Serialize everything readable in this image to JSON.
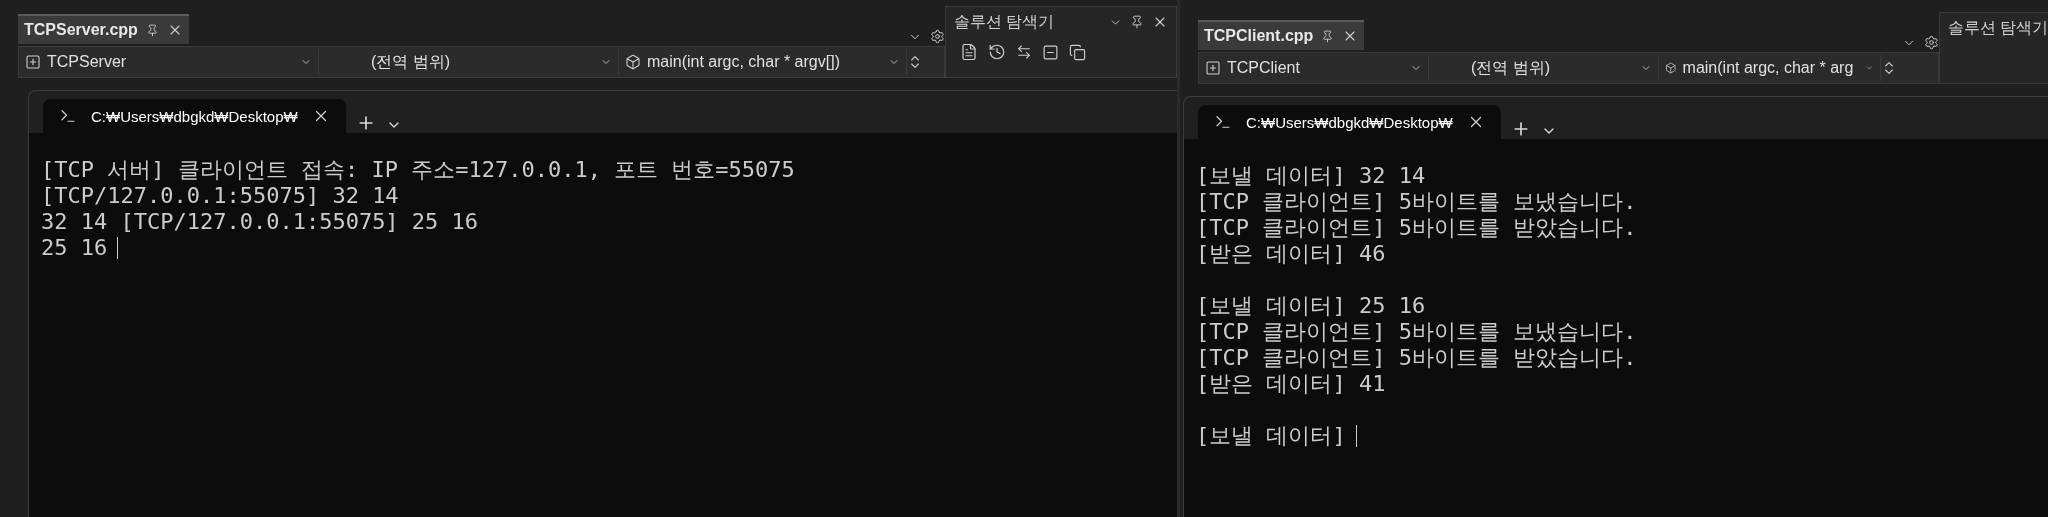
{
  "panes": [
    {
      "file_tab": {
        "label": "TCPServer.cpp",
        "selected": true
      },
      "nav": {
        "project": "TCPServer",
        "scope": "(전역 범위)",
        "member": "main(int argc, char * argv[])"
      },
      "explorer": {
        "title": "솔루션 탐색기"
      },
      "console": {
        "tab_title": "C:₩Users₩dbgkd₩Desktop₩",
        "cursor": true,
        "blocks": [
          {
            "lines": [
              "[TCP 서버] 클라이언트 접속: IP 주소=127.0.0.1, 포트 번호=55075",
              "[TCP/127.0.0.1:55075] 32 14",
              "32 14 [TCP/127.0.0.1:55075] 25 16",
              "25 16"
            ]
          }
        ]
      }
    },
    {
      "file_tab": {
        "label": "TCPClient.cpp",
        "selected": true
      },
      "nav": {
        "project": "TCPClient",
        "scope": "(전역 범위)",
        "member": "main(int argc, char * arg"
      },
      "explorer": {
        "title": "솔루션 탐색기"
      },
      "console": {
        "tab_title": "C:₩Users₩dbgkd₩Desktop₩",
        "cursor": true,
        "blocks": [
          {
            "lines": [
              "[보낼 데이터] 32 14",
              "[TCP 클라이언트] 5바이트를 보냈습니다.",
              "[TCP 클라이언트] 5바이트를 받았습니다.",
              "[받은 데이터] 46"
            ]
          },
          {
            "lines": [
              "[보낼 데이터] 25 16",
              "[TCP 클라이언트] 5바이트를 보냈습니다.",
              "[TCP 클라이언트] 5바이트를 받았습니다.",
              "[받은 데이터] 41"
            ]
          },
          {
            "lines": [
              "[보낼 데이터]"
            ]
          }
        ]
      }
    }
  ]
}
